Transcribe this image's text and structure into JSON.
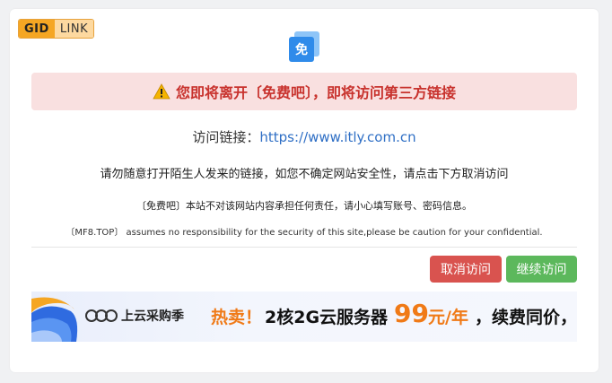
{
  "logo": {
    "gid": "GID",
    "link": "LINK"
  },
  "site_icon": {
    "glyph": "免",
    "color": "#2f8bea"
  },
  "alert": {
    "text": "您即将离开〔免费吧〕，即将访问第三方链接",
    "color": "#c8322d"
  },
  "visit": {
    "label": "访问链接：",
    "url": "https://www.itly.com.cn"
  },
  "notice": "请勿随意打开陌生人发来的链接，如您不确定网站安全性，请点击下方取消访问",
  "disclaimer_cn": "〔免费吧〕本站不对该网站内容承担任何责任，请小心填写账号、密码信息。",
  "disclaimer_en": "〔MF8.TOP〕 assumes no responsibility for the security of this site,please be caution for your confidential.",
  "buttons": {
    "cancel": "取消访问",
    "continue": "继续访问"
  },
  "banner": {
    "brand": "上云采购季",
    "hot": "热卖！",
    "promo": "2核2G云服务器",
    "price": "99",
    "unit": "元/年",
    "tail": "，续费同价，"
  }
}
